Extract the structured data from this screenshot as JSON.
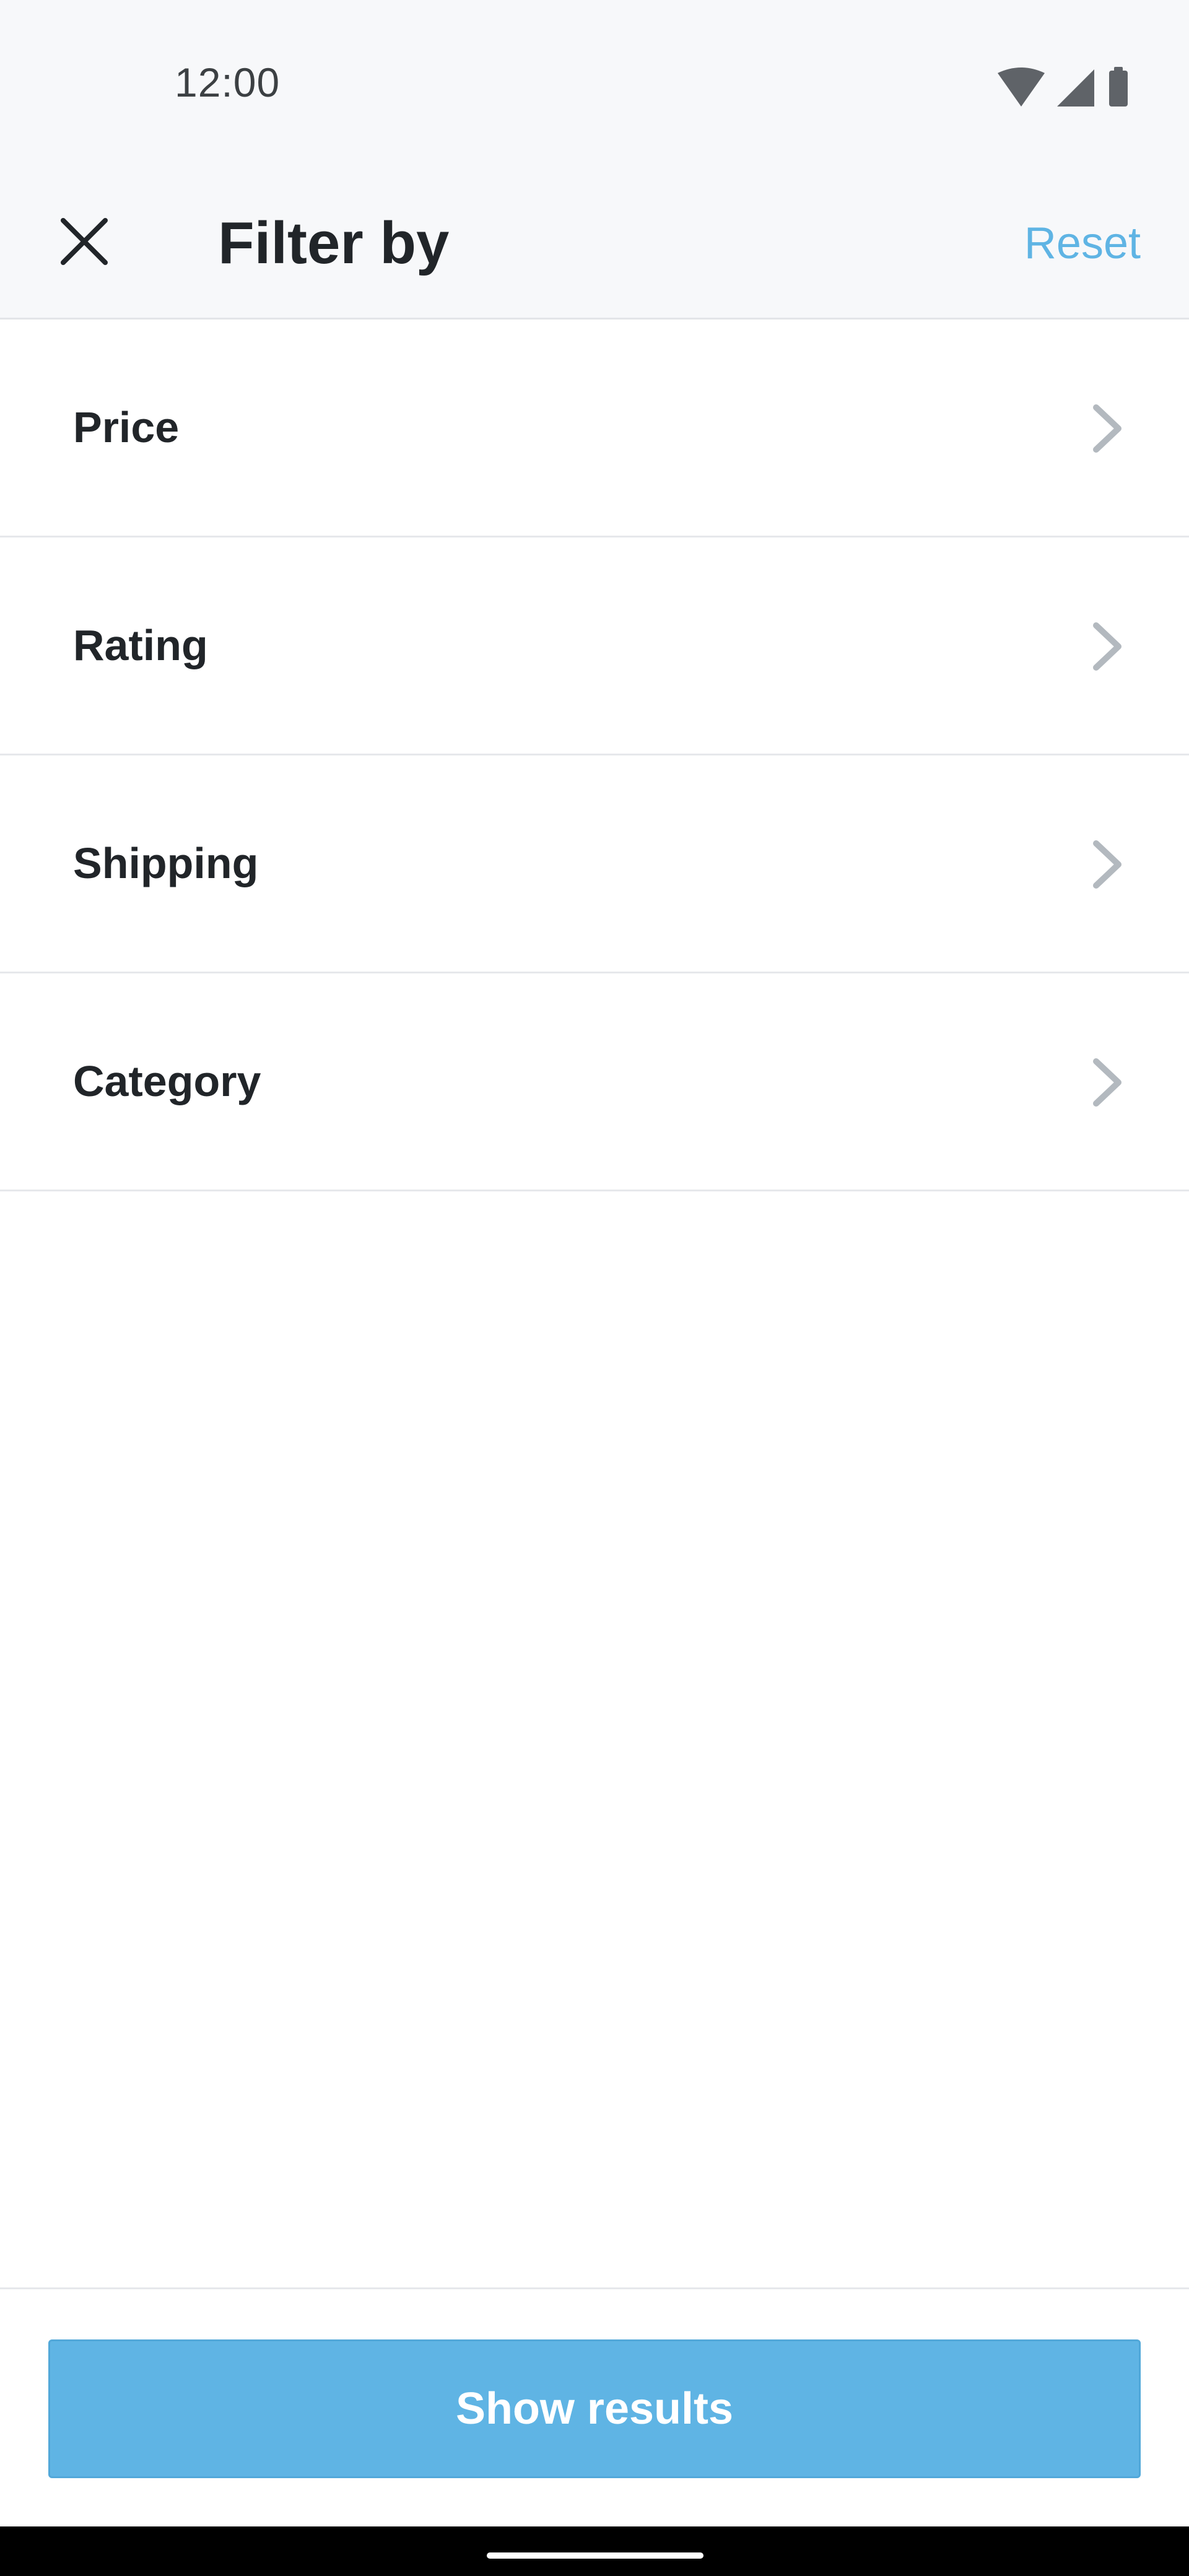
{
  "status_bar": {
    "time": "12:00",
    "icons": [
      "wifi-icon",
      "cell-signal-icon",
      "battery-icon"
    ]
  },
  "header": {
    "close_icon": "close-icon",
    "title": "Filter by",
    "reset_label": "Reset"
  },
  "filters": [
    {
      "label": "Price"
    },
    {
      "label": "Rating"
    },
    {
      "label": "Shipping"
    },
    {
      "label": "Category"
    }
  ],
  "footer": {
    "show_results_label": "Show results"
  },
  "colors": {
    "accent": "#5fb4e4",
    "header_bg": "#f7f8fa",
    "text": "#212529",
    "chevron": "#b3b9bf",
    "divider": "#e6e8eb"
  }
}
